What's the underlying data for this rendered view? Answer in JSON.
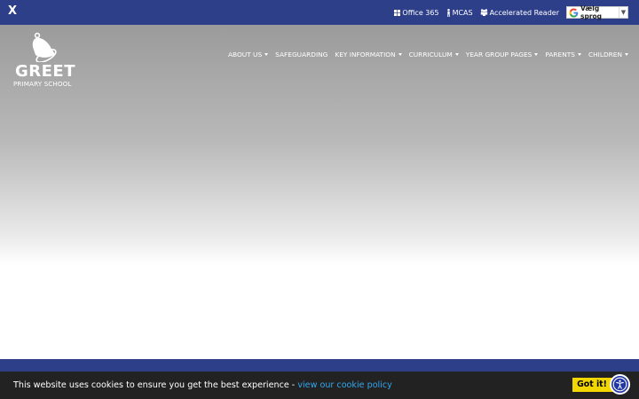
{
  "topbar": {
    "close_label": "X",
    "links": [
      {
        "label": "Office 365",
        "icon": "windows-icon"
      },
      {
        "label": "MCAS",
        "icon": "person-icon"
      },
      {
        "label": "Accelerated Reader",
        "icon": "readers-icon"
      }
    ],
    "translate_label": "Vælg sprog",
    "translate_arrow": "▼"
  },
  "logo": {
    "name": "GREET",
    "subtitle": "PRIMARY SCHOOL"
  },
  "nav": {
    "items": [
      {
        "label": "ABOUT US",
        "dropdown": true
      },
      {
        "label": "SAFEGUARDING",
        "dropdown": false
      },
      {
        "label": "KEY INFORMATION",
        "dropdown": true
      },
      {
        "label": "CURRICULUM",
        "dropdown": true
      },
      {
        "label": "YEAR GROUP PAGES",
        "dropdown": true
      },
      {
        "label": "PARENTS",
        "dropdown": true
      },
      {
        "label": "CHILDREN",
        "dropdown": true
      }
    ]
  },
  "cookie": {
    "message": "This website uses cookies to ensure you get the best experience - ",
    "policy_link": "view our cookie policy",
    "accept_label": "Got it!"
  },
  "colors": {
    "brand_blue": "#2e3f8a",
    "cookie_bg": "#222222",
    "accept_yellow": "#f1d600",
    "link_blue": "#31a8f0",
    "a11y_blue": "#2338a7"
  }
}
